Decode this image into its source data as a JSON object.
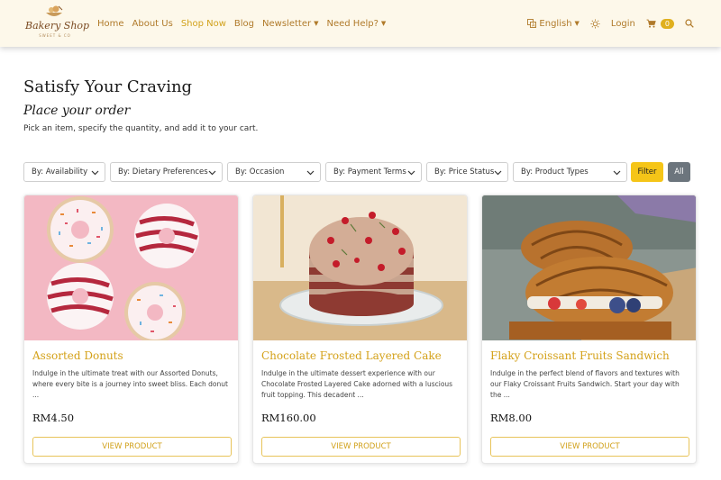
{
  "brand": {
    "name": "Bakery Shop",
    "tagline": "SWEET & CO"
  },
  "nav": {
    "links": [
      {
        "label": "Home",
        "active": false
      },
      {
        "label": "About Us",
        "active": false
      },
      {
        "label": "Shop Now",
        "active": true
      },
      {
        "label": "Blog",
        "active": false
      },
      {
        "label": "Newsletter",
        "active": false
      },
      {
        "label": "Need Help?",
        "active": false
      }
    ],
    "language": "English",
    "login": "Login",
    "cart_count": "0"
  },
  "page": {
    "title": "Satisfy Your Craving",
    "subtitle": "Place your order",
    "description": "Pick an item, specify the quantity, and add it to your cart."
  },
  "filters": {
    "selects": [
      "By: Availability",
      "By: Dietary Preferences",
      "By: Occasion",
      "By: Payment Terms",
      "By: Price Status",
      "By: Product Types"
    ],
    "filter_button": "Filter",
    "all_button": "All"
  },
  "products": [
    {
      "name": "Assorted Donuts",
      "description": "Indulge in the ultimate treat with our Assorted Donuts, where every bite is a journey into sweet bliss. Each donut ...",
      "price": "RM4.50",
      "button": "VIEW PRODUCT",
      "image_icon": "donuts-photo"
    },
    {
      "name": "Chocolate Frosted Layered Cake",
      "description": "Indulge in the ultimate dessert experience with our Chocolate Frosted Layered Cake adorned with a luscious fruit topping. This decadent ...",
      "price": "RM160.00",
      "button": "VIEW PRODUCT",
      "image_icon": "cake-photo"
    },
    {
      "name": "Flaky Croissant Fruits Sandwich",
      "description": "Indulge in the perfect blend of flavors and textures with our Flaky Croissant Fruits Sandwich. Start your day with the ...",
      "price": "RM8.00",
      "button": "VIEW PRODUCT",
      "image_icon": "croissant-photo"
    }
  ],
  "colors": {
    "accent": "#d4a119",
    "navbar_bg": "#fdf8ea",
    "filter_button": "#f5c518",
    "all_button": "#6c757d"
  }
}
